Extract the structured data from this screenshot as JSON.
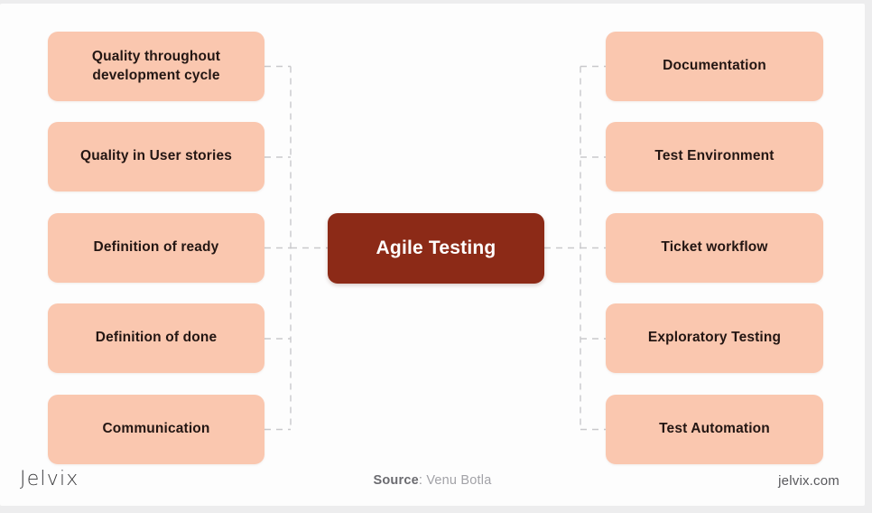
{
  "diagram": {
    "title_node": {
      "label": "Agile Testing",
      "fill": "#8C2A17",
      "text_color": "#FFFFFF"
    },
    "leaf_fill": "#FAC7AF",
    "leaf_text_color": "#231613",
    "connector_color": "#C9C9CC",
    "connector_style": "dashed",
    "left_branches": [
      {
        "label": "Quality throughout development cycle"
      },
      {
        "label": "Quality in User stories"
      },
      {
        "label": "Definition of ready"
      },
      {
        "label": "Definition of done"
      },
      {
        "label": "Communication"
      }
    ],
    "right_branches": [
      {
        "label": "Documentation"
      },
      {
        "label": "Test Environment"
      },
      {
        "label": "Ticket workflow"
      },
      {
        "label": "Exploratory Testing"
      },
      {
        "label": "Test Automation"
      }
    ]
  },
  "footer": {
    "logo": "Jelvix",
    "source_label": "Source",
    "source_separator": ": ",
    "source_value": "Venu Botla",
    "site_url": "jelvix.com"
  }
}
